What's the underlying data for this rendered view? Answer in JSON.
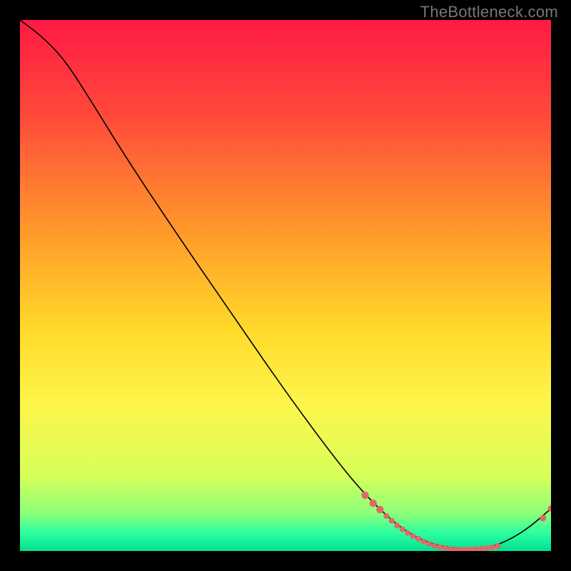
{
  "watermark": "TheBottleneck.com",
  "chart_data": {
    "type": "line",
    "title": "",
    "xlabel": "",
    "ylabel": "",
    "xlim": [
      0,
      100
    ],
    "ylim": [
      0,
      100
    ],
    "background_gradient": {
      "stops": [
        {
          "offset": 0.0,
          "color": "#ff1a44"
        },
        {
          "offset": 0.18,
          "color": "#ff4a3a"
        },
        {
          "offset": 0.4,
          "color": "#ff9a2a"
        },
        {
          "offset": 0.58,
          "color": "#ffd92a"
        },
        {
          "offset": 0.72,
          "color": "#fff54a"
        },
        {
          "offset": 0.86,
          "color": "#d6ff5a"
        },
        {
          "offset": 0.93,
          "color": "#8aff7a"
        },
        {
          "offset": 0.965,
          "color": "#2fffa0"
        },
        {
          "offset": 1.0,
          "color": "#00e090"
        }
      ]
    },
    "series": [
      {
        "name": "curve",
        "type": "line",
        "color": "#000000",
        "width": 1.6,
        "points": [
          {
            "x": 0,
            "y": 100.0
          },
          {
            "x": 4,
            "y": 97.0
          },
          {
            "x": 8,
            "y": 93.0
          },
          {
            "x": 12,
            "y": 87.0
          },
          {
            "x": 20,
            "y": 74.0
          },
          {
            "x": 30,
            "y": 59.0
          },
          {
            "x": 40,
            "y": 44.5
          },
          {
            "x": 50,
            "y": 30.0
          },
          {
            "x": 60,
            "y": 16.5
          },
          {
            "x": 66,
            "y": 9.5
          },
          {
            "x": 72,
            "y": 4.0
          },
          {
            "x": 78,
            "y": 1.0
          },
          {
            "x": 84,
            "y": 0.3
          },
          {
            "x": 88,
            "y": 0.5
          },
          {
            "x": 92,
            "y": 2.0
          },
          {
            "x": 96,
            "y": 4.5
          },
          {
            "x": 100,
            "y": 8.0
          }
        ]
      },
      {
        "name": "markers",
        "type": "scatter",
        "color": "#e06868",
        "radius_default": 4.5,
        "points": [
          {
            "x": 65.0,
            "y": 10.5,
            "r": 5.2
          },
          {
            "x": 66.5,
            "y": 9.0,
            "r": 5.2
          },
          {
            "x": 67.8,
            "y": 7.8,
            "r": 5.2
          },
          {
            "x": 69.0,
            "y": 6.6,
            "r": 4.0
          },
          {
            "x": 70.0,
            "y": 5.7,
            "r": 4.0
          },
          {
            "x": 71.0,
            "y": 4.8,
            "r": 4.0
          },
          {
            "x": 72.0,
            "y": 4.1,
            "r": 4.0
          },
          {
            "x": 73.0,
            "y": 3.4,
            "r": 4.0
          },
          {
            "x": 74.0,
            "y": 2.8,
            "r": 4.0
          },
          {
            "x": 75.0,
            "y": 2.3,
            "r": 4.0
          },
          {
            "x": 76.0,
            "y": 1.8,
            "r": 4.0
          },
          {
            "x": 77.0,
            "y": 1.35,
            "r": 4.0
          },
          {
            "x": 78.0,
            "y": 1.0,
            "r": 4.0
          },
          {
            "x": 79.0,
            "y": 0.75,
            "r": 4.0
          },
          {
            "x": 80.0,
            "y": 0.55,
            "r": 4.0
          },
          {
            "x": 81.0,
            "y": 0.4,
            "r": 4.0
          },
          {
            "x": 82.0,
            "y": 0.3,
            "r": 4.0
          },
          {
            "x": 83.0,
            "y": 0.28,
            "r": 4.0
          },
          {
            "x": 84.0,
            "y": 0.3,
            "r": 4.0
          },
          {
            "x": 85.0,
            "y": 0.34,
            "r": 4.0
          },
          {
            "x": 86.0,
            "y": 0.4,
            "r": 4.0
          },
          {
            "x": 87.0,
            "y": 0.46,
            "r": 4.0
          },
          {
            "x": 88.0,
            "y": 0.55,
            "r": 4.0
          },
          {
            "x": 89.0,
            "y": 0.7,
            "r": 4.0
          },
          {
            "x": 90.0,
            "y": 0.95,
            "r": 4.0
          },
          {
            "x": 98.5,
            "y": 6.2,
            "r": 4.5
          },
          {
            "x": 100.0,
            "y": 8.0,
            "r": 4.5
          }
        ]
      }
    ]
  }
}
